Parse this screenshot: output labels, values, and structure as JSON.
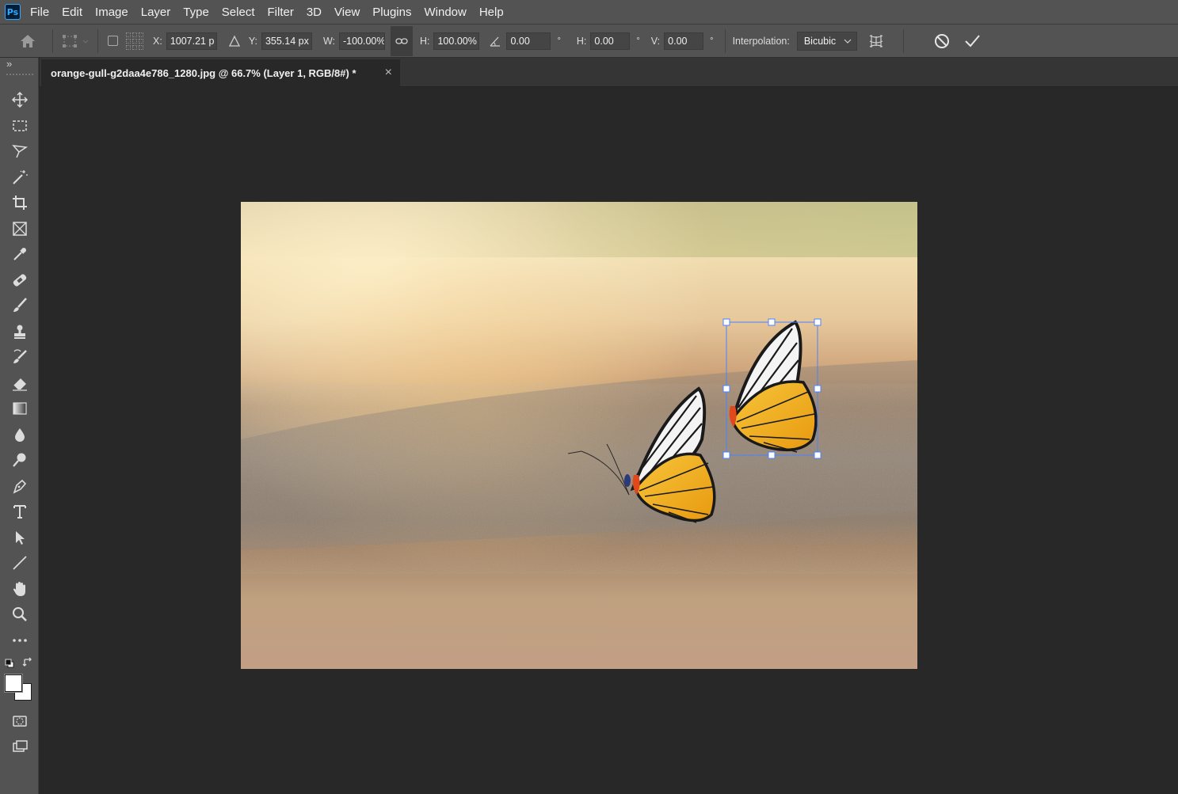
{
  "app": {
    "logo_text": "Ps"
  },
  "menu": [
    "File",
    "Edit",
    "Image",
    "Layer",
    "Type",
    "Select",
    "Filter",
    "3D",
    "View",
    "Plugins",
    "Window",
    "Help"
  ],
  "options": {
    "x_label": "X:",
    "x_value": "1007.21 p",
    "y_label": "Y:",
    "y_value": "355.14 px",
    "w_label": "W:",
    "w_value": "-100.00%",
    "h_label": "H:",
    "h_value": "100.00%",
    "angle_value": "0.00",
    "angle_unit": "°",
    "skew_h_label": "H:",
    "skew_h_value": "0.00",
    "skew_h_unit": "°",
    "skew_v_label": "V:",
    "skew_v_value": "0.00",
    "skew_v_unit": "°",
    "interpolation_label": "Interpolation:",
    "interpolation_value": "Bicubic"
  },
  "document": {
    "tab_title": "orange-gull-g2daa4e786_1280.jpg @ 66.7% (Layer 1, RGB/8#) *",
    "close_glyph": "×"
  },
  "toolbar": {
    "collapse_glyph": "»"
  },
  "colors": {
    "foreground": "#ffffff",
    "background": "#ffffff",
    "ui_bg": "#535353",
    "canvas_bg": "#282828",
    "accent": "#31a8ff"
  }
}
